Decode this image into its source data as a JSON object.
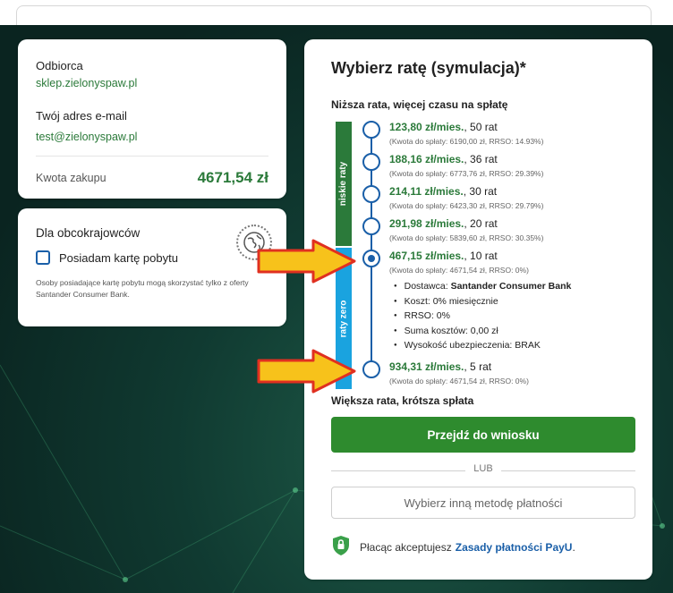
{
  "recipient": {
    "recipient_label": "Odbiorca",
    "recipient_value": "sklep.zielonyspaw.pl",
    "email_label": "Twój adres e-mail",
    "email_value": "test@zielonyspaw.pl",
    "amount_label": "Kwota zakupu",
    "amount_value": "4671,54 zł"
  },
  "foreign": {
    "title": "Dla obcokrajowców",
    "checkbox_label": "Posiadam kartę pobytu",
    "note": "Osoby posiadające kartę pobytu mogą skorzystać tylko z oferty Santander Consumer Bank."
  },
  "installments": {
    "title": "Wybierz ratę (symulacja)*",
    "top_caption": "Niższa rata, więcej czasu na spłatę",
    "bottom_caption": "Większa rata, krótsza spłata",
    "band_low": "niskie raty",
    "band_zero": "raty zero",
    "options": [
      {
        "amount": "123,80 zł/mies.",
        "term": ", 50 rat",
        "detail": "(Kwota do spłaty: 6190,00 zł, RRSO: 14.93%)"
      },
      {
        "amount": "188,16 zł/mies.",
        "term": ", 36 rat",
        "detail": "(Kwota do spłaty: 6773,76 zł, RRSO: 29.39%)"
      },
      {
        "amount": "214,11 zł/mies.",
        "term": ", 30 rat",
        "detail": "(Kwota do spłaty: 6423,30 zł, RRSO: 29.79%)"
      },
      {
        "amount": "291,98 zł/mies.",
        "term": ", 20 rat",
        "detail": "(Kwota do spłaty: 5839,60 zł, RRSO: 30.35%)"
      },
      {
        "amount": "467,15 zł/mies.",
        "term": ", 10 rat",
        "detail": "(Kwota do spłaty: 4671,54 zł, RRSO: 0%)"
      },
      {
        "amount": "934,31 zł/mies.",
        "term": ", 5 rat",
        "detail": "(Kwota do spłaty: 4671,54 zł, RRSO: 0%)"
      }
    ],
    "details": {
      "provider_label": "Dostawca: ",
      "provider_value": "Santander Consumer Bank",
      "cost": "Koszt: 0% miesięcznie",
      "rrso": "RRSO: 0%",
      "total_cost": "Suma kosztów: 0,00 zł",
      "insurance": "Wysokość ubezpieczenia: BRAK"
    },
    "proceed_button": "Przejdź do wniosku",
    "or_label": "LUB",
    "other_method_button": "Wybierz inną metodę płatności",
    "terms_text": "Płacąc akceptujesz",
    "terms_link": "Zasady płatności PayU",
    "terms_end": "."
  },
  "colors": {
    "brand_green": "#2b7a3a",
    "accent_blue": "#1a5fa8",
    "zero_band": "#1aa3df",
    "arrow_fill": "#f7c21b",
    "arrow_stroke": "#e03020"
  }
}
